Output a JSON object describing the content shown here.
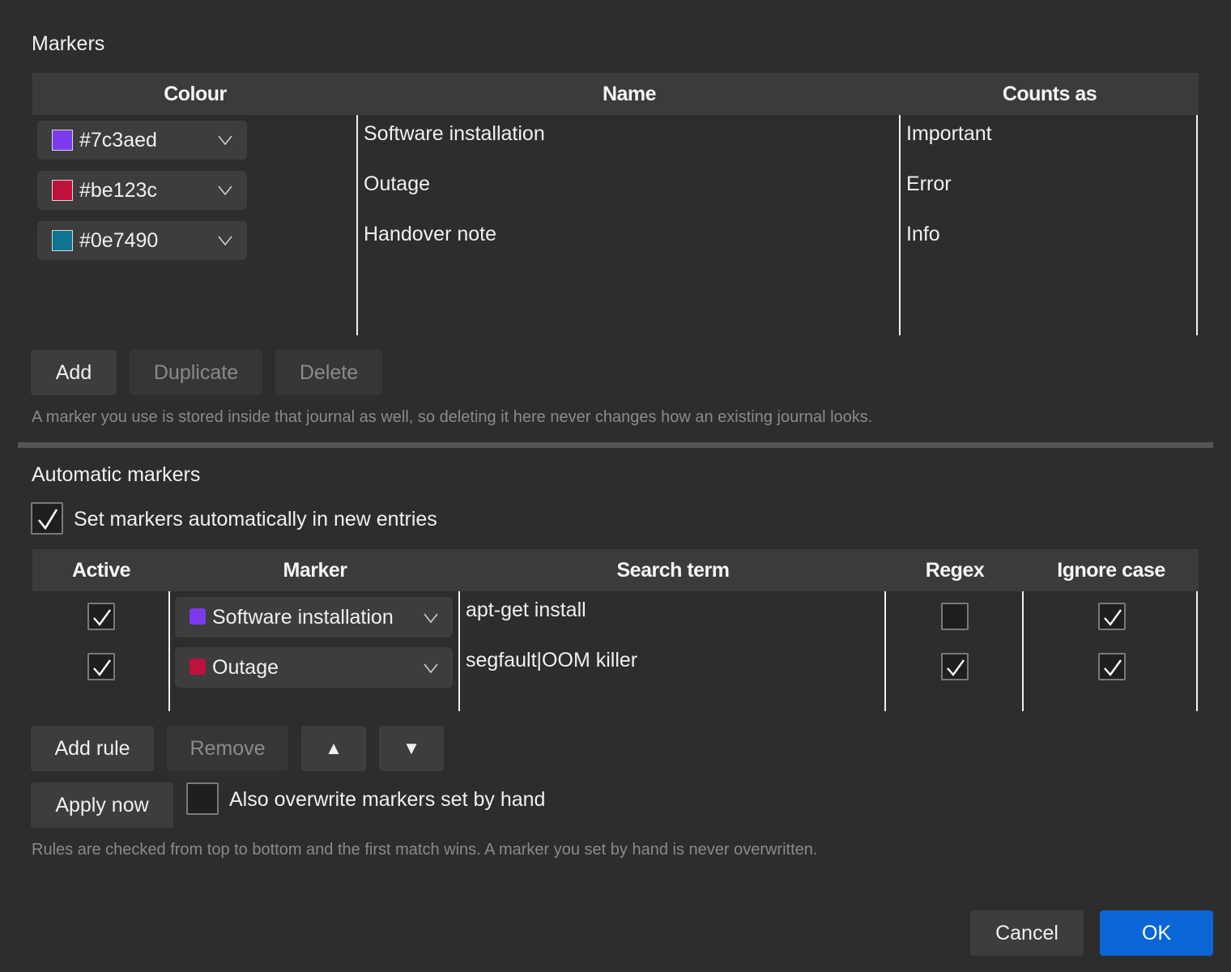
{
  "markers_section": {
    "title": "Markers",
    "columns": {
      "colour": "Colour",
      "name": "Name",
      "counts_as": "Counts as"
    },
    "rows": [
      {
        "colour_hex": "#7c3aed",
        "colour_label": "#7c3aed",
        "name": "Software installation",
        "counts_as": "Important"
      },
      {
        "colour_hex": "#be123c",
        "colour_label": "#be123c",
        "name": "Outage",
        "counts_as": "Error"
      },
      {
        "colour_hex": "#0e7490",
        "colour_label": "#0e7490",
        "name": "Handover note",
        "counts_as": "Info"
      }
    ],
    "buttons": {
      "add": "Add",
      "duplicate": "Duplicate",
      "delete": "Delete"
    },
    "hint": "A marker you use is stored inside that journal as well, so deleting it here never changes how an existing journal looks."
  },
  "automatic_section": {
    "title": "Automatic markers",
    "enable_label": "Set markers automatically in new entries",
    "enable_checked": true,
    "columns": {
      "active": "Active",
      "marker": "Marker",
      "search_term": "Search term",
      "regex": "Regex",
      "ignore_case": "Ignore case"
    },
    "rules": [
      {
        "active": true,
        "marker": "Software installation",
        "marker_color": "#7c3aed",
        "search_term": "apt-get install",
        "regex": false,
        "ignore_case": true
      },
      {
        "active": true,
        "marker": "Outage",
        "marker_color": "#be123c",
        "search_term": "segfault|OOM killer",
        "regex": true,
        "ignore_case": true
      }
    ],
    "buttons": {
      "add_rule": "Add rule",
      "remove": "Remove",
      "move_up": "▲",
      "move_down": "▼",
      "apply_now": "Apply now"
    },
    "overwrite_label": "Also overwrite markers set by hand",
    "overwrite_checked": false,
    "hint": "Rules are checked from top to bottom and the first match wins. A marker you set by hand is never overwritten."
  },
  "dialog_buttons": {
    "cancel": "Cancel",
    "ok": "OK"
  },
  "colors": {
    "accent": "#0a66d6",
    "background": "#2d2d2d",
    "header": "#3b3b3b"
  }
}
